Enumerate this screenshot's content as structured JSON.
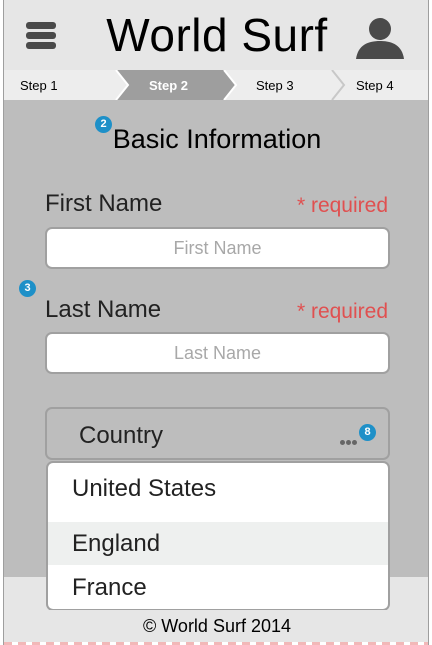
{
  "header": {
    "title": "World Surf",
    "menu_icon": "hamburger-menu-icon",
    "user_icon": "user-avatar-icon"
  },
  "steps": [
    {
      "label": "Step 1",
      "active": false
    },
    {
      "label": "Step 2",
      "active": true
    },
    {
      "label": "Step 3",
      "active": false
    },
    {
      "label": "Step 4",
      "active": false
    }
  ],
  "form": {
    "section_title": "Basic Information",
    "badges": {
      "section": "2",
      "last_name": "3",
      "country": "8"
    },
    "first_name": {
      "label": "First Name",
      "required": "* required",
      "placeholder": "First Name",
      "value": ""
    },
    "last_name": {
      "label": "Last Name",
      "required": "* required",
      "placeholder": "Last Name",
      "value": ""
    },
    "country": {
      "label": "Country",
      "options": [
        "United States",
        "England",
        "France"
      ],
      "highlighted": "England"
    }
  },
  "footer": {
    "text": "© World Surf 2014"
  },
  "colors": {
    "background": "#bdbdbd",
    "header": "#e6e6e6",
    "active_step": "#9e9e9e",
    "required": "#e05050",
    "badge": "#1e90c8"
  }
}
